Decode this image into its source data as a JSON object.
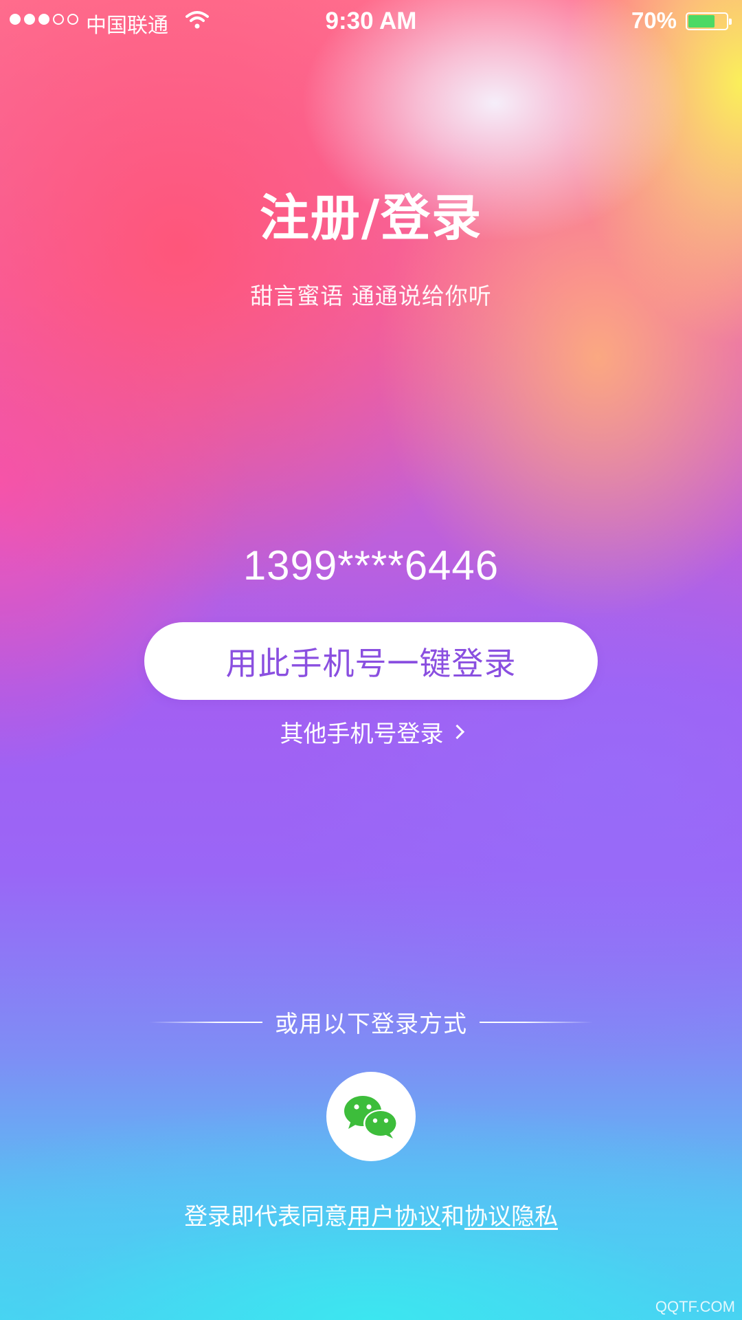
{
  "status_bar": {
    "signal_bars_filled": 3,
    "signal_bars_total": 5,
    "carrier": "中国联通",
    "wifi_icon": "wifi-icon",
    "time": "9:30 AM",
    "battery_percent_label": "70%",
    "battery_level": 0.7,
    "battery_color": "#4cd964"
  },
  "header": {
    "title": "注册/登录",
    "subtitle": "甜言蜜语 通通说给你听"
  },
  "login": {
    "phone_number": "1399****6446",
    "one_click_label": "用此手机号一键登录",
    "one_click_text_color": "#8a4fe0",
    "other_phone_label": "其他手机号登录",
    "other_phone_icon": "chevron-right-icon"
  },
  "alt_login": {
    "divider_text": "或用以下登录方式",
    "wechat_icon": "wechat-icon",
    "wechat_color": "#3dbd3b"
  },
  "agreement": {
    "prefix": "登录即代表同意",
    "user_agreement": "用户协议",
    "and": "和",
    "privacy": "协议隐私"
  },
  "watermark": "QQTF.COM"
}
